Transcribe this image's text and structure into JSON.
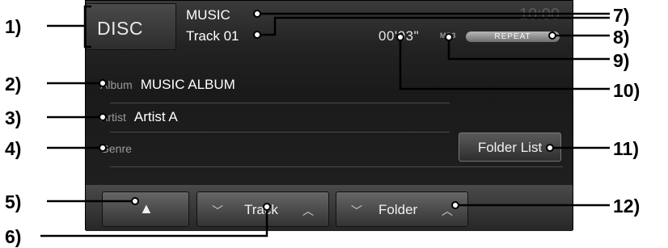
{
  "header": {
    "source": "DISC",
    "title": "MUSIC",
    "track": "Track 01",
    "clock": "10:00",
    "elapsed": "00'03\"",
    "format": "MP3",
    "repeat": "REPEAT"
  },
  "info": {
    "album_label": "Album",
    "album_value": "MUSIC ALBUM",
    "artist_label": "Artist",
    "artist_value": "Artist A",
    "genre_label": "Genre"
  },
  "buttons": {
    "folder_list": "Folder List",
    "track": "Track",
    "folder": "Folder"
  },
  "callouts": [
    "1)",
    "2)",
    "3)",
    "4)",
    "5)",
    "6)",
    "7)",
    "8)",
    "9)",
    "10)",
    "11)",
    "12)"
  ]
}
